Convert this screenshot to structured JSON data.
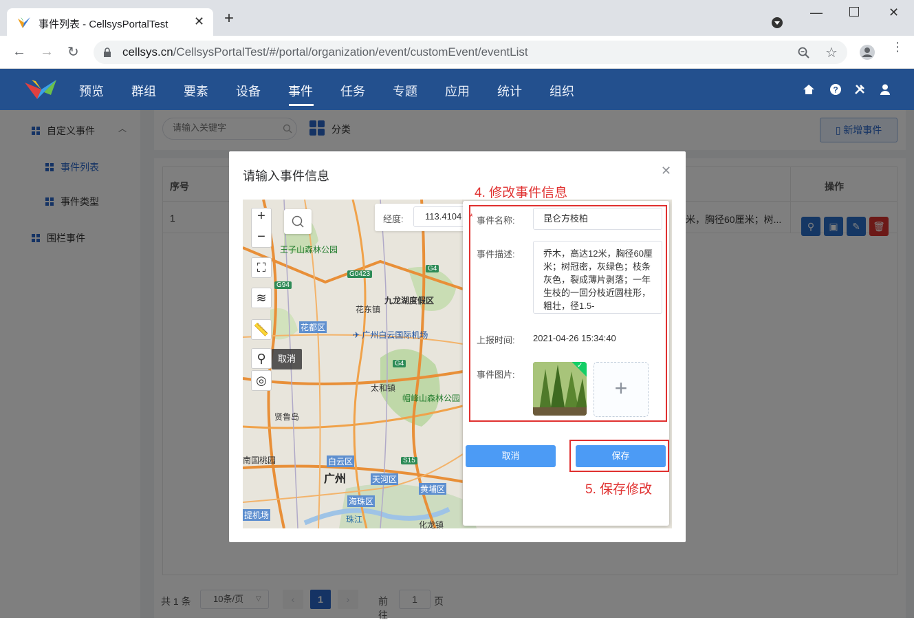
{
  "browser": {
    "tab_title": "事件列表 - CellsysPortalTest",
    "url_host": "cellsys.cn",
    "url_path": "/CellsysPortalTest/#/portal/organization/event/customEvent/eventList"
  },
  "nav": {
    "items": [
      "预览",
      "群组",
      "要素",
      "设备",
      "事件",
      "任务",
      "专题",
      "应用",
      "统计",
      "组织"
    ],
    "active": "事件"
  },
  "sidebar": {
    "group1": "自定义事件",
    "sub1": "事件列表",
    "sub2": "事件类型",
    "group2": "围栏事件"
  },
  "toolbar": {
    "search_placeholder": "请输入关键字",
    "category_label": "分类",
    "add_label": "新增事件"
  },
  "table": {
    "headers": {
      "index": "序号",
      "ops": "操作"
    },
    "row": {
      "index": "1",
      "desc_tail": "米，胸径60厘米；树..."
    }
  },
  "pager": {
    "total": "共 1 条",
    "page_size": "10条/页",
    "current": "1",
    "goto_label": "前往",
    "goto_value": "1",
    "page_unit": "页"
  },
  "modal": {
    "title": "请输入事件信息",
    "lng_label": "经度:",
    "lng_value": "113.4104",
    "cancel_tip": "取消",
    "form": {
      "name_label": "事件名称:",
      "name_value": "昆仑方枝柏",
      "desc_label": "事件描述:",
      "desc_value": "乔木，高达12米，胸径60厘米；树冠密，灰绿色；枝条灰色，裂成薄片剥落；一年生枝的一回分枝近圆柱形，粗壮，径1.5-",
      "time_label": "上报时间:",
      "time_value": "2021-04-26 15:34:40",
      "image_label": "事件图片:"
    },
    "cancel_button": "取消",
    "save_button": "保存"
  },
  "annotations": {
    "step4": "4. 修改事件信息",
    "step5": "5. 保存修改"
  },
  "map_labels": {
    "park1": "王子山森林公园",
    "town1": "花东镇",
    "district1": "九龙湖度假区",
    "district_huadu": "花都区",
    "airport": "广州白云国际机场",
    "town2": "太和镇",
    "park2": "帽峰山森林公园",
    "island": "贤鲁岛",
    "park3": "南国桃园",
    "district_baiyun": "白云区",
    "city": "广州",
    "district_tianhe": "天河区",
    "district_huangpu": "黄埔区",
    "district_haizhu": "海珠区",
    "airport2": "提机场",
    "river": "珠江",
    "town3": "化龙镇",
    "road1": "G0423",
    "road2": "G4",
    "road3": "G94",
    "road4": "S15",
    "road5": "G4"
  },
  "colors": {
    "nav_bg": "#23508e",
    "primary": "#4c9bf5",
    "danger": "#e0302f",
    "annotation": "#e0302f"
  }
}
